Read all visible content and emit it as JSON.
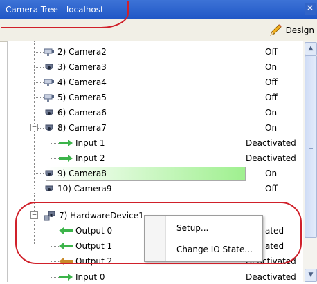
{
  "window": {
    "title": "Camera Tree - localhost"
  },
  "toolbar": {
    "design_label": "Design"
  },
  "tree": {
    "rows": [
      {
        "label": "2) Camera2",
        "state": "Off"
      },
      {
        "label": "3) Camera3",
        "state": "On"
      },
      {
        "label": "4) Camera4",
        "state": "Off"
      },
      {
        "label": "5) Camera5",
        "state": "Off"
      },
      {
        "label": "6) Camera6",
        "state": "On"
      },
      {
        "label": "8) Camera7",
        "state": "On"
      },
      {
        "label": "Input 1",
        "state": "Deactivated"
      },
      {
        "label": "Input 2",
        "state": "Deactivated"
      },
      {
        "label": "9) Camera8",
        "state": "On"
      },
      {
        "label": "10) Camera9",
        "state": "Off"
      },
      {
        "label": "7) HardwareDevice1",
        "state": ""
      },
      {
        "label": "Output 0",
        "state": "ated"
      },
      {
        "label": "Output 1",
        "state": "ated"
      },
      {
        "label": "Output 2",
        "state": "Deactivated"
      },
      {
        "label": "Input 0",
        "state": "Deactivated"
      }
    ]
  },
  "context_menu": {
    "items": [
      "Setup...",
      "Change IO State..."
    ]
  },
  "colors": {
    "title_bar": "#2b5fcc",
    "selected_gradient_end": "#9ff08f",
    "annotation": "#d0202a"
  }
}
